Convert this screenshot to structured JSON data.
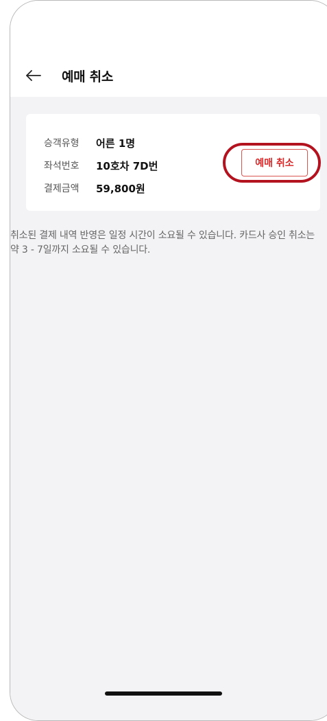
{
  "header": {
    "back_icon": "arrow-left-icon",
    "title": "예매 취소"
  },
  "ticket": {
    "rows": [
      {
        "label": "승객유형",
        "value": "어른 1명"
      },
      {
        "label": "좌석번호",
        "value": "10호차 7D번"
      },
      {
        "label": "결제금액",
        "value": "59,800원"
      }
    ],
    "cancel_label": "예매 취소"
  },
  "notice": {
    "text": "취소된 결제 내역 반영은 일정 시간이 소요될 수 있습니다. 카드사 승인 취소는 약 3 - 7일까지 소요될 수 있습니다."
  },
  "colors": {
    "accent": "#d92b2b",
    "highlight": "#b3121f",
    "background": "#f3f3f5"
  }
}
